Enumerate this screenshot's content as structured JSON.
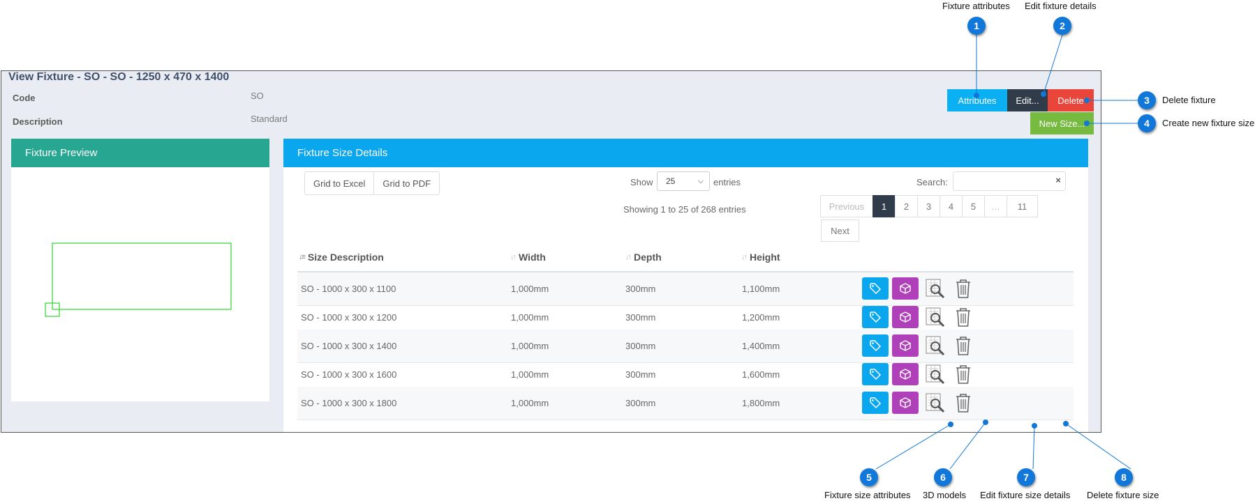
{
  "view": {
    "title": "View Fixture - SO - SO - 1250 x 470 x 1400",
    "code_label": "Code",
    "code_value": "SO",
    "description_label": "Description",
    "description_value": "Standard"
  },
  "toolbar": {
    "attributes_label": "Attributes",
    "edit_label": "Edit...",
    "delete_label": "Delete",
    "new_size_label": "New Size..."
  },
  "preview": {
    "title": "Fixture Preview"
  },
  "details": {
    "title": "Fixture Size Details",
    "export_excel": "Grid to Excel",
    "export_pdf": "Grid to PDF",
    "show_label": "Show",
    "show_value": "25",
    "entries_label": "entries",
    "search_label": "Search:",
    "search_clear": "×",
    "info": "Showing 1 to 25 of 268 entries",
    "pager": [
      "Previous",
      "1",
      "2",
      "3",
      "4",
      "5",
      "…",
      "11"
    ],
    "next": "Next",
    "columns": [
      "Size Description",
      "Width",
      "Depth",
      "Height"
    ],
    "rows": [
      {
        "desc": "SO - 1000 x 300 x 1100",
        "width": "1,000mm",
        "depth": "300mm",
        "height": "1,100mm"
      },
      {
        "desc": "SO - 1000 x 300 x 1200",
        "width": "1,000mm",
        "depth": "300mm",
        "height": "1,200mm"
      },
      {
        "desc": "SO - 1000 x 300 x 1400",
        "width": "1,000mm",
        "depth": "300mm",
        "height": "1,400mm"
      },
      {
        "desc": "SO - 1000 x 300 x 1600",
        "width": "1,000mm",
        "depth": "300mm",
        "height": "1,600mm"
      },
      {
        "desc": "SO - 1000 x 300 x 1800",
        "width": "1,000mm",
        "depth": "300mm",
        "height": "1,800mm"
      }
    ]
  },
  "callouts": [
    {
      "num": "1",
      "label": "Fixture attributes"
    },
    {
      "num": "2",
      "label": "Edit fixture details"
    },
    {
      "num": "3",
      "label": "Delete fixture"
    },
    {
      "num": "4",
      "label": "Create new fixture size"
    },
    {
      "num": "5",
      "label": "Fixture size attributes"
    },
    {
      "num": "6",
      "label": "3D models"
    },
    {
      "num": "7",
      "label": "Edit fixture size details"
    },
    {
      "num": "8",
      "label": "Delete fixture size"
    }
  ],
  "colors": {
    "attributes": "#0ab0f2",
    "edit": "#303c49",
    "delete": "#e9453a",
    "new_size": "#76ba40",
    "preview_header": "#27a691",
    "details_header": "#0aa6ee",
    "callout": "#1177d8",
    "cube_button": "#b040b9"
  }
}
